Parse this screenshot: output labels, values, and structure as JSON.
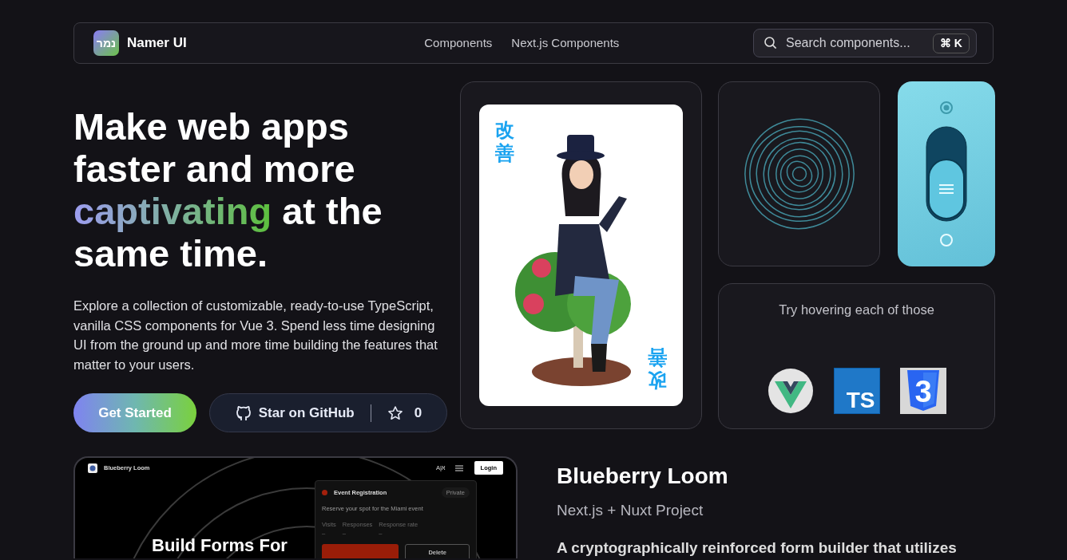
{
  "navbar": {
    "logo_text": "נמר",
    "brand": "Namer UI",
    "links": [
      {
        "label": "Components"
      },
      {
        "label": "Next.js Components"
      }
    ],
    "search": {
      "placeholder": "Search components...",
      "shortcut": [
        "⌘",
        "K"
      ]
    }
  },
  "hero": {
    "headline_start": "Make web apps faster and more",
    "headline_highlight": "captivating",
    "headline_end": "at the same time.",
    "description": "Explore a collection of customizable, ready-to-use TypeScript, vanilla CSS components for Vue 3. Spend less time designing UI from the ground up and more time building the features that matter to your users.",
    "buttons": [
      {
        "kind": "primary",
        "label": "Get Started"
      },
      {
        "kind": "github",
        "label": "Star on GitHub",
        "count": "0"
      }
    ]
  },
  "showcase": {
    "card": {
      "corner_texts": [
        "改善",
        "改善"
      ]
    },
    "toggle": {
      "on": false
    },
    "hint": "Try hovering each of those",
    "tech_icons": [
      {
        "kind": "vue"
      },
      {
        "kind": "typescript",
        "label": "TS"
      },
      {
        "kind": "css",
        "label": "3"
      }
    ]
  },
  "project": {
    "preview": {
      "brand": "Blueberry Loom",
      "language_toggle": "A|א",
      "login": "Login",
      "form_card": {
        "title": "Event Registration",
        "status": "Private",
        "description": "Reserve your spot for the Miami event",
        "stats": [
          {
            "label": "Visits",
            "value": "–"
          },
          {
            "label": "Responses",
            "value": "–"
          },
          {
            "label": "Response rate",
            "value": "–"
          }
        ],
        "delete": "Delete"
      },
      "headline": "Build Forms For"
    },
    "title": "Blueberry Loom",
    "subtitle": "Next.js + Nuxt Project",
    "description": "A cryptographically reinforced form builder that utilizes"
  }
}
